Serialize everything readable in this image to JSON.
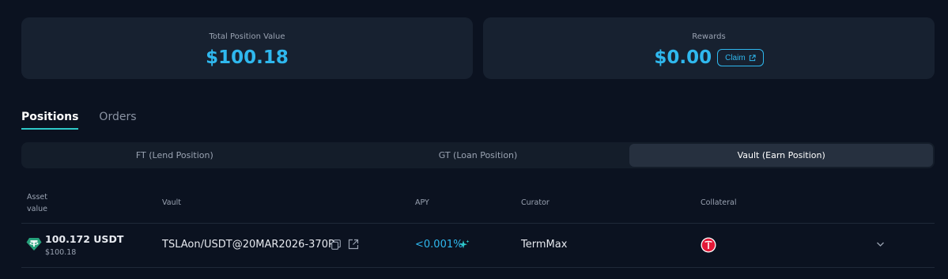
{
  "summary": {
    "total_label": "Total Position Value",
    "total_value": "$100.18",
    "rewards_label": "Rewards",
    "rewards_value": "$0.00",
    "claim_label": "Claim"
  },
  "tabs": [
    {
      "label": "Positions",
      "active": true
    },
    {
      "label": "Orders",
      "active": false
    }
  ],
  "segments": [
    {
      "label": "FT (Lend Position)",
      "active": false
    },
    {
      "label": "GT (Loan Position)",
      "active": false
    },
    {
      "label": "Vault (Earn Position)",
      "active": true
    }
  ],
  "table": {
    "headers": {
      "asset": "Asset",
      "asset_sub": "value",
      "vault": "Vault",
      "apy": "APY",
      "curator": "Curator",
      "collateral": "Collateral"
    },
    "rows": [
      {
        "asset_amount": "100.172 USDT",
        "asset_value": "$100.18",
        "asset_icon": "tether-icon",
        "vault": "TSLAon/USDT@20MAR2026-370P",
        "apy": "<0.001%",
        "curator": "TermMax",
        "collateral_icon": "tesla-icon"
      }
    ]
  },
  "colors": {
    "background": "#0b1220",
    "card": "#172130",
    "accent": "#2fb8ee",
    "tab_underline": "#2ec8c8",
    "tether": "#26a17b",
    "tesla": "#e31937"
  }
}
